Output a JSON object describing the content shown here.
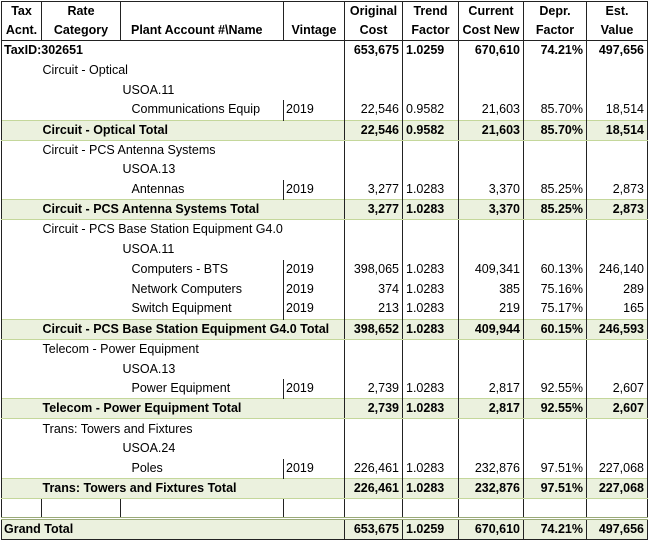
{
  "headers": {
    "tax_acnt": [
      "Tax",
      "Acnt."
    ],
    "rate_category": [
      "Rate",
      "Category"
    ],
    "plant_account": "Plant Account #\\Name",
    "vintage": "Vintage",
    "original_cost": [
      "Original",
      "Cost"
    ],
    "trend_factor": [
      "Trend",
      "Factor"
    ],
    "current_cost_new": [
      "Current",
      "Cost New"
    ],
    "depr_factor": [
      "Depr.",
      "Factor"
    ],
    "est_value": [
      "Est.",
      "Value"
    ]
  },
  "taxid": {
    "label": "TaxID:302651",
    "original_cost": "653,675",
    "trend_factor": "1.0259",
    "current_cost_new": "670,610",
    "depr_factor": "74.21%",
    "est_value": "497,656"
  },
  "groups": [
    {
      "category": "Circuit - Optical",
      "usoa": "USOA.11",
      "items": [
        {
          "name": "Communications Equip",
          "vintage": "2019",
          "original_cost": "22,546",
          "trend_factor": "0.9582",
          "current_cost_new": "21,603",
          "depr_factor": "85.70%",
          "est_value": "18,514"
        }
      ],
      "total": {
        "label": "Circuit - Optical Total",
        "original_cost": "22,546",
        "trend_factor": "0.9582",
        "current_cost_new": "21,603",
        "depr_factor": "85.70%",
        "est_value": "18,514"
      }
    },
    {
      "category": "Circuit - PCS Antenna Systems",
      "usoa": "USOA.13",
      "items": [
        {
          "name": "Antennas",
          "vintage": "2019",
          "original_cost": "3,277",
          "trend_factor": "1.0283",
          "current_cost_new": "3,370",
          "depr_factor": "85.25%",
          "est_value": "2,873"
        }
      ],
      "total": {
        "label": "Circuit - PCS Antenna Systems Total",
        "original_cost": "3,277",
        "trend_factor": "1.0283",
        "current_cost_new": "3,370",
        "depr_factor": "85.25%",
        "est_value": "2,873"
      }
    },
    {
      "category": "Circuit - PCS Base Station Equipment G4.0",
      "usoa": "USOA.11",
      "items": [
        {
          "name": "Computers - BTS",
          "vintage": "2019",
          "original_cost": "398,065",
          "trend_factor": "1.0283",
          "current_cost_new": "409,341",
          "depr_factor": "60.13%",
          "est_value": "246,140"
        },
        {
          "name": "Network Computers",
          "vintage": "2019",
          "original_cost": "374",
          "trend_factor": "1.0283",
          "current_cost_new": "385",
          "depr_factor": "75.16%",
          "est_value": "289"
        },
        {
          "name": "Switch Equipment",
          "vintage": "2019",
          "original_cost": "213",
          "trend_factor": "1.0283",
          "current_cost_new": "219",
          "depr_factor": "75.17%",
          "est_value": "165"
        }
      ],
      "total": {
        "label": "Circuit - PCS Base Station Equipment G4.0 Total",
        "original_cost": "398,652",
        "trend_factor": "1.0283",
        "current_cost_new": "409,944",
        "depr_factor": "60.15%",
        "est_value": "246,593"
      }
    },
    {
      "category": "Telecom - Power Equipment",
      "usoa": "USOA.13",
      "items": [
        {
          "name": "Power Equipment",
          "vintage": "2019",
          "original_cost": "2,739",
          "trend_factor": "1.0283",
          "current_cost_new": "2,817",
          "depr_factor": "92.55%",
          "est_value": "2,607"
        }
      ],
      "total": {
        "label": "Telecom - Power Equipment Total",
        "original_cost": "2,739",
        "trend_factor": "1.0283",
        "current_cost_new": "2,817",
        "depr_factor": "92.55%",
        "est_value": "2,607"
      }
    },
    {
      "category": "Trans: Towers and Fixtures",
      "usoa": "USOA.24",
      "items": [
        {
          "name": "Poles",
          "vintage": "2019",
          "original_cost": "226,461",
          "trend_factor": "1.0283",
          "current_cost_new": "232,876",
          "depr_factor": "97.51%",
          "est_value": "227,068"
        }
      ],
      "total": {
        "label": "Trans: Towers and Fixtures Total",
        "original_cost": "226,461",
        "trend_factor": "1.0283",
        "current_cost_new": "232,876",
        "depr_factor": "97.51%",
        "est_value": "227,068"
      }
    }
  ],
  "grand_total": {
    "label": "Grand Total",
    "original_cost": "653,675",
    "trend_factor": "1.0259",
    "current_cost_new": "670,610",
    "depr_factor": "74.21%",
    "est_value": "497,656"
  },
  "colors": {
    "total_fill": "#ebf1de",
    "border": "#222222"
  }
}
